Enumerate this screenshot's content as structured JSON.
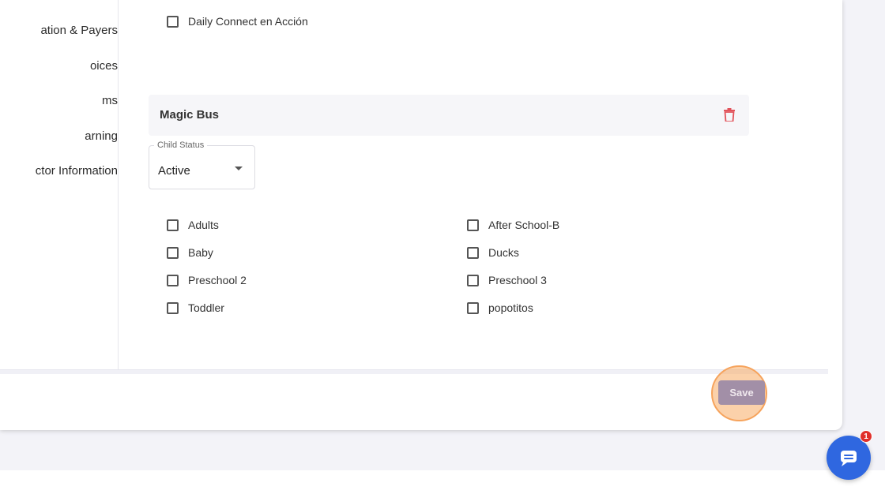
{
  "sidebar": {
    "items": [
      {
        "label": "ation & Payers"
      },
      {
        "label": "oices"
      },
      {
        "label": "ms"
      },
      {
        "label": "arning"
      },
      {
        "label": "ctor Information"
      }
    ]
  },
  "previous_group": {
    "checkboxes": [
      {
        "label": "Daily Connect en Acción",
        "checked": false
      }
    ]
  },
  "group": {
    "title": "Magic Bus",
    "child_status": {
      "label": "Child Status",
      "value": "Active"
    },
    "classrooms": [
      {
        "label": "Adults",
        "checked": false
      },
      {
        "label": "After School-B",
        "checked": false
      },
      {
        "label": "Baby",
        "checked": false
      },
      {
        "label": "Ducks",
        "checked": false
      },
      {
        "label": "Preschool 2",
        "checked": false
      },
      {
        "label": "Preschool 3",
        "checked": false
      },
      {
        "label": "Toddler",
        "checked": false
      },
      {
        "label": "popotitos",
        "checked": false
      }
    ]
  },
  "footer": {
    "save_label": "Save"
  },
  "chat": {
    "badge_count": "1"
  },
  "colors": {
    "accent": "#2f67e0",
    "trash": "#e2535b",
    "save_button": "#a28fa7",
    "highlight": "#f6a35c"
  }
}
